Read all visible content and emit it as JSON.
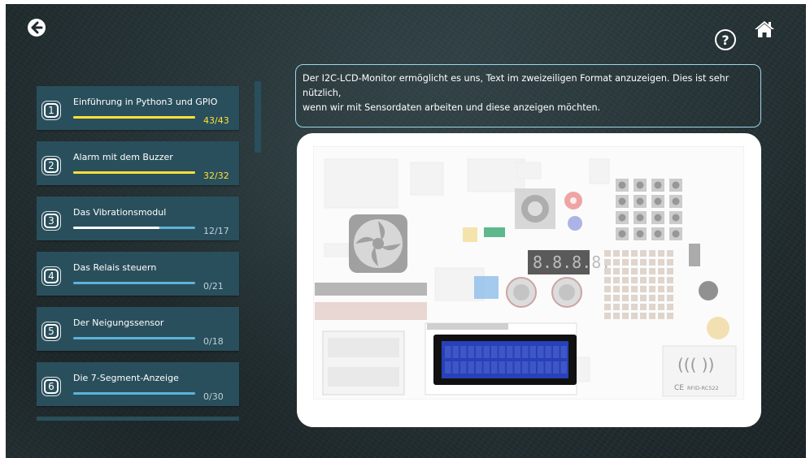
{
  "nav": {
    "back_icon": "arrow-left-circle-icon",
    "help_icon": "question-circle-icon",
    "help_label": "?",
    "home_icon": "home-icon"
  },
  "lessons": [
    {
      "number": "1",
      "title": "Einführung in Python3 und GPIO",
      "progress": "43/43",
      "completed": 43,
      "total": 43
    },
    {
      "number": "2",
      "title": "Alarm mit dem Buzzer",
      "progress": "32/32",
      "completed": 32,
      "total": 32
    },
    {
      "number": "3",
      "title": "Das Vibrationsmodul",
      "progress": "12/17",
      "completed": 12,
      "total": 17
    },
    {
      "number": "4",
      "title": "Das Relais steuern",
      "progress": "0/21",
      "completed": 0,
      "total": 21
    },
    {
      "number": "5",
      "title": "Der Neigungssensor",
      "progress": "0/18",
      "completed": 0,
      "total": 18
    },
    {
      "number": "6",
      "title": "Die 7-Segment-Anzeige",
      "progress": "0/30",
      "completed": 0,
      "total": 30
    }
  ],
  "description": {
    "line1": "Der I2C-LCD-Monitor ermöglicht es uns, Text im zweizeiligen Format anzuzeigen. Dies ist sehr nützlich,",
    "line2": "wenn wir mit Sensordaten arbeiten und diese anzeigen möchten."
  },
  "board": {
    "segment_display_text": "8.8.8.8.",
    "rfid_label": "RFID-RC522",
    "ce_mark": "CE",
    "colors": {
      "lcd_screen": "#2840b8",
      "lcd_bezel": "#111111",
      "highlight": "#ffffff",
      "buzzer": "#e86a6a",
      "terminal": "#36a872",
      "dht_sensor": "#7fb5e8"
    }
  },
  "theme": {
    "card_bg": "#2a4f5c",
    "progress_done": "#ffe135",
    "progress_track": "#5eb3d9",
    "description_border": "#9fd5ea"
  }
}
